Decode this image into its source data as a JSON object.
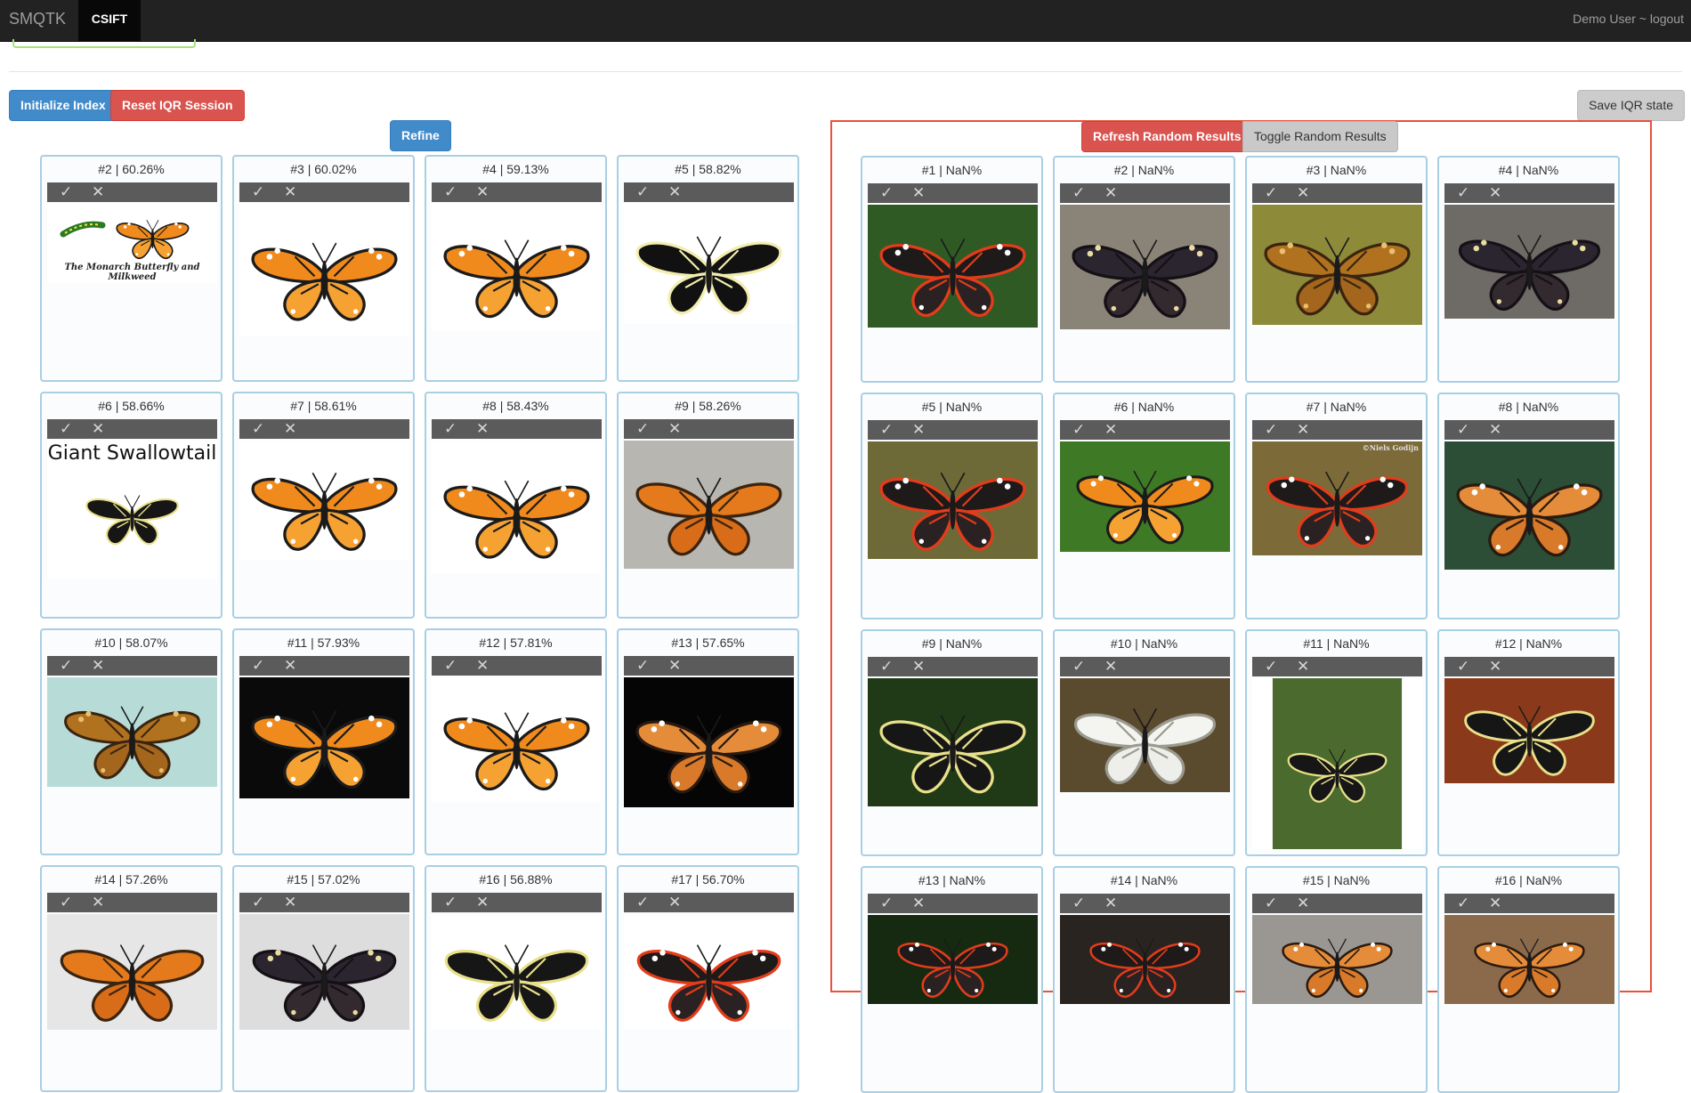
{
  "nav": {
    "brand": "SMQTK",
    "active_tab": "CSIFT",
    "user_text": "Demo User ~ logout"
  },
  "toolbar": {
    "init_index": "Initialize Index",
    "reset_session": "Reset IQR Session",
    "save_state": "Save IQR state",
    "refine": "Refine",
    "refresh_random": "Refresh Random Results",
    "toggle_random": "Toggle Random Results"
  },
  "icons": {
    "check": "✓",
    "cross": "✕"
  },
  "colors": {
    "navbar": "#222222",
    "primary": "#428bca",
    "danger": "#d9534f",
    "panel_border": "#e8513a",
    "tile_border": "#a9cfe3",
    "tile_bar": "#5b5b5b"
  },
  "results": [
    {
      "label": "#2 | 60.26%",
      "image": "monarch-with-caterpillar",
      "caption": "The Monarch Butterfly and Milkweed"
    },
    {
      "label": "#3 | 60.02%",
      "image": "monarch-illustration"
    },
    {
      "label": "#4 | 59.13%",
      "image": "monarch-photo"
    },
    {
      "label": "#5 | 58.82%",
      "image": "zebra-longwing"
    },
    {
      "label": "#6 | 58.66%",
      "image": "giant-swallowtail-poster",
      "caption": "Giant Swallowtail"
    },
    {
      "label": "#7 | 58.61%",
      "image": "monarch-side"
    },
    {
      "label": "#8 | 58.43%",
      "image": "monarch-angled"
    },
    {
      "label": "#9 | 58.26%",
      "image": "copper-butterfly"
    },
    {
      "label": "#10 | 58.07%",
      "image": "buckeye-on-blue"
    },
    {
      "label": "#11 | 57.93%",
      "image": "monarch-on-black"
    },
    {
      "label": "#12 | 57.81%",
      "image": "monarch-bright"
    },
    {
      "label": "#13 | 57.65%",
      "image": "painted-lady-on-black"
    },
    {
      "label": "#14 | 57.26%",
      "image": "orange-butterfly"
    },
    {
      "label": "#15 | 57.02%",
      "image": "mourning-cloak"
    },
    {
      "label": "#16 | 56.88%",
      "image": "swallowtail-white"
    },
    {
      "label": "#17 | 56.70%",
      "image": "red-admiral"
    }
  ],
  "random_results": [
    {
      "label": "#1 | NaN%",
      "image": "postman-on-leaf"
    },
    {
      "label": "#2 | NaN%",
      "image": "mourning-cloak-bark"
    },
    {
      "label": "#3 | NaN%",
      "image": "buckeye-on-grass"
    },
    {
      "label": "#4 | NaN%",
      "image": "mourning-cloak-rock"
    },
    {
      "label": "#5 | NaN%",
      "image": "red-admiral-ground"
    },
    {
      "label": "#6 | NaN%",
      "image": "monarch-green"
    },
    {
      "label": "#7 | NaN%",
      "image": "red-admiral-brown",
      "caption": "©Niels Godijn"
    },
    {
      "label": "#8 | NaN%",
      "image": "painted-lady-grass"
    },
    {
      "label": "#9 | NaN%",
      "image": "swallowtail-leaves"
    },
    {
      "label": "#10 | NaN%",
      "image": "cabbage-white"
    },
    {
      "label": "#11 | NaN%",
      "image": "giant-swallowtail-leaf"
    },
    {
      "label": "#12 | NaN%",
      "image": "swallowtail-flowers"
    },
    {
      "label": "#13 | NaN%",
      "image": "red-admiral-dark"
    },
    {
      "label": "#14 | NaN%",
      "image": "red-admiral-rocks"
    },
    {
      "label": "#15 | NaN%",
      "image": "butterfly-stones"
    },
    {
      "label": "#16 | NaN%",
      "image": "painted-lady-flowers"
    }
  ]
}
